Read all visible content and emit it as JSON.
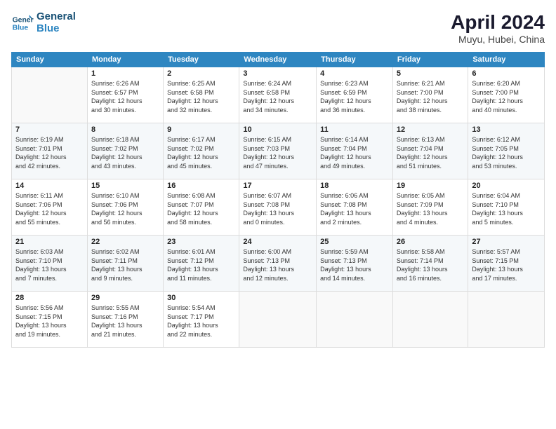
{
  "header": {
    "logo_line1": "General",
    "logo_line2": "Blue",
    "month_title": "April 2024",
    "location": "Muyu, Hubei, China"
  },
  "weekdays": [
    "Sunday",
    "Monday",
    "Tuesday",
    "Wednesday",
    "Thursday",
    "Friday",
    "Saturday"
  ],
  "weeks": [
    [
      {
        "day": "",
        "info": ""
      },
      {
        "day": "1",
        "info": "Sunrise: 6:26 AM\nSunset: 6:57 PM\nDaylight: 12 hours\nand 30 minutes."
      },
      {
        "day": "2",
        "info": "Sunrise: 6:25 AM\nSunset: 6:58 PM\nDaylight: 12 hours\nand 32 minutes."
      },
      {
        "day": "3",
        "info": "Sunrise: 6:24 AM\nSunset: 6:58 PM\nDaylight: 12 hours\nand 34 minutes."
      },
      {
        "day": "4",
        "info": "Sunrise: 6:23 AM\nSunset: 6:59 PM\nDaylight: 12 hours\nand 36 minutes."
      },
      {
        "day": "5",
        "info": "Sunrise: 6:21 AM\nSunset: 7:00 PM\nDaylight: 12 hours\nand 38 minutes."
      },
      {
        "day": "6",
        "info": "Sunrise: 6:20 AM\nSunset: 7:00 PM\nDaylight: 12 hours\nand 40 minutes."
      }
    ],
    [
      {
        "day": "7",
        "info": "Sunrise: 6:19 AM\nSunset: 7:01 PM\nDaylight: 12 hours\nand 42 minutes."
      },
      {
        "day": "8",
        "info": "Sunrise: 6:18 AM\nSunset: 7:02 PM\nDaylight: 12 hours\nand 43 minutes."
      },
      {
        "day": "9",
        "info": "Sunrise: 6:17 AM\nSunset: 7:02 PM\nDaylight: 12 hours\nand 45 minutes."
      },
      {
        "day": "10",
        "info": "Sunrise: 6:15 AM\nSunset: 7:03 PM\nDaylight: 12 hours\nand 47 minutes."
      },
      {
        "day": "11",
        "info": "Sunrise: 6:14 AM\nSunset: 7:04 PM\nDaylight: 12 hours\nand 49 minutes."
      },
      {
        "day": "12",
        "info": "Sunrise: 6:13 AM\nSunset: 7:04 PM\nDaylight: 12 hours\nand 51 minutes."
      },
      {
        "day": "13",
        "info": "Sunrise: 6:12 AM\nSunset: 7:05 PM\nDaylight: 12 hours\nand 53 minutes."
      }
    ],
    [
      {
        "day": "14",
        "info": "Sunrise: 6:11 AM\nSunset: 7:06 PM\nDaylight: 12 hours\nand 55 minutes."
      },
      {
        "day": "15",
        "info": "Sunrise: 6:10 AM\nSunset: 7:06 PM\nDaylight: 12 hours\nand 56 minutes."
      },
      {
        "day": "16",
        "info": "Sunrise: 6:08 AM\nSunset: 7:07 PM\nDaylight: 12 hours\nand 58 minutes."
      },
      {
        "day": "17",
        "info": "Sunrise: 6:07 AM\nSunset: 7:08 PM\nDaylight: 13 hours\nand 0 minutes."
      },
      {
        "day": "18",
        "info": "Sunrise: 6:06 AM\nSunset: 7:08 PM\nDaylight: 13 hours\nand 2 minutes."
      },
      {
        "day": "19",
        "info": "Sunrise: 6:05 AM\nSunset: 7:09 PM\nDaylight: 13 hours\nand 4 minutes."
      },
      {
        "day": "20",
        "info": "Sunrise: 6:04 AM\nSunset: 7:10 PM\nDaylight: 13 hours\nand 5 minutes."
      }
    ],
    [
      {
        "day": "21",
        "info": "Sunrise: 6:03 AM\nSunset: 7:10 PM\nDaylight: 13 hours\nand 7 minutes."
      },
      {
        "day": "22",
        "info": "Sunrise: 6:02 AM\nSunset: 7:11 PM\nDaylight: 13 hours\nand 9 minutes."
      },
      {
        "day": "23",
        "info": "Sunrise: 6:01 AM\nSunset: 7:12 PM\nDaylight: 13 hours\nand 11 minutes."
      },
      {
        "day": "24",
        "info": "Sunrise: 6:00 AM\nSunset: 7:13 PM\nDaylight: 13 hours\nand 12 minutes."
      },
      {
        "day": "25",
        "info": "Sunrise: 5:59 AM\nSunset: 7:13 PM\nDaylight: 13 hours\nand 14 minutes."
      },
      {
        "day": "26",
        "info": "Sunrise: 5:58 AM\nSunset: 7:14 PM\nDaylight: 13 hours\nand 16 minutes."
      },
      {
        "day": "27",
        "info": "Sunrise: 5:57 AM\nSunset: 7:15 PM\nDaylight: 13 hours\nand 17 minutes."
      }
    ],
    [
      {
        "day": "28",
        "info": "Sunrise: 5:56 AM\nSunset: 7:15 PM\nDaylight: 13 hours\nand 19 minutes."
      },
      {
        "day": "29",
        "info": "Sunrise: 5:55 AM\nSunset: 7:16 PM\nDaylight: 13 hours\nand 21 minutes."
      },
      {
        "day": "30",
        "info": "Sunrise: 5:54 AM\nSunset: 7:17 PM\nDaylight: 13 hours\nand 22 minutes."
      },
      {
        "day": "",
        "info": ""
      },
      {
        "day": "",
        "info": ""
      },
      {
        "day": "",
        "info": ""
      },
      {
        "day": "",
        "info": ""
      }
    ]
  ]
}
